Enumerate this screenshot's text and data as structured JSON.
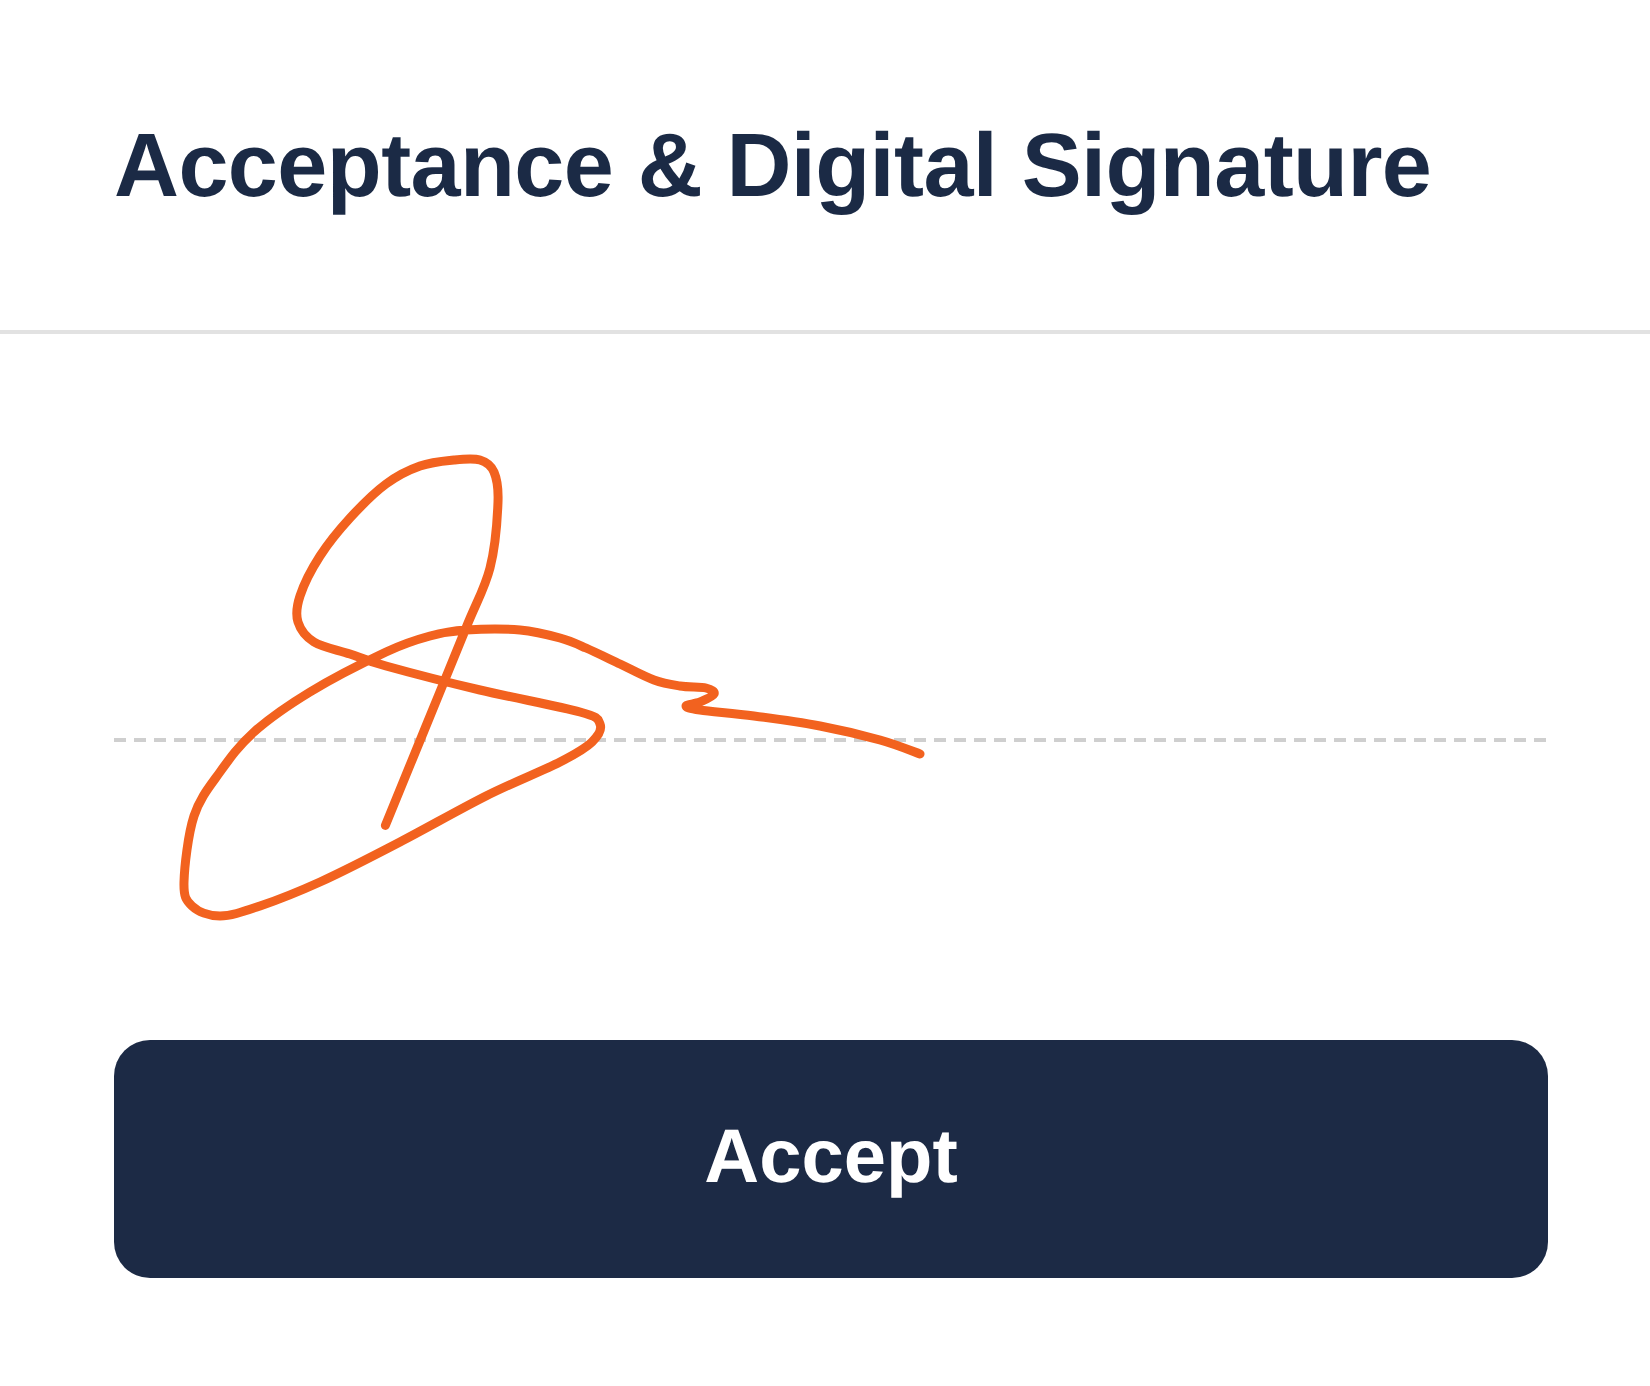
{
  "header": {
    "title": "Acceptance & Digital Signature"
  },
  "signature_pad": {
    "signed": true
  },
  "buttons": [
    {
      "label": "Accept"
    }
  ]
}
